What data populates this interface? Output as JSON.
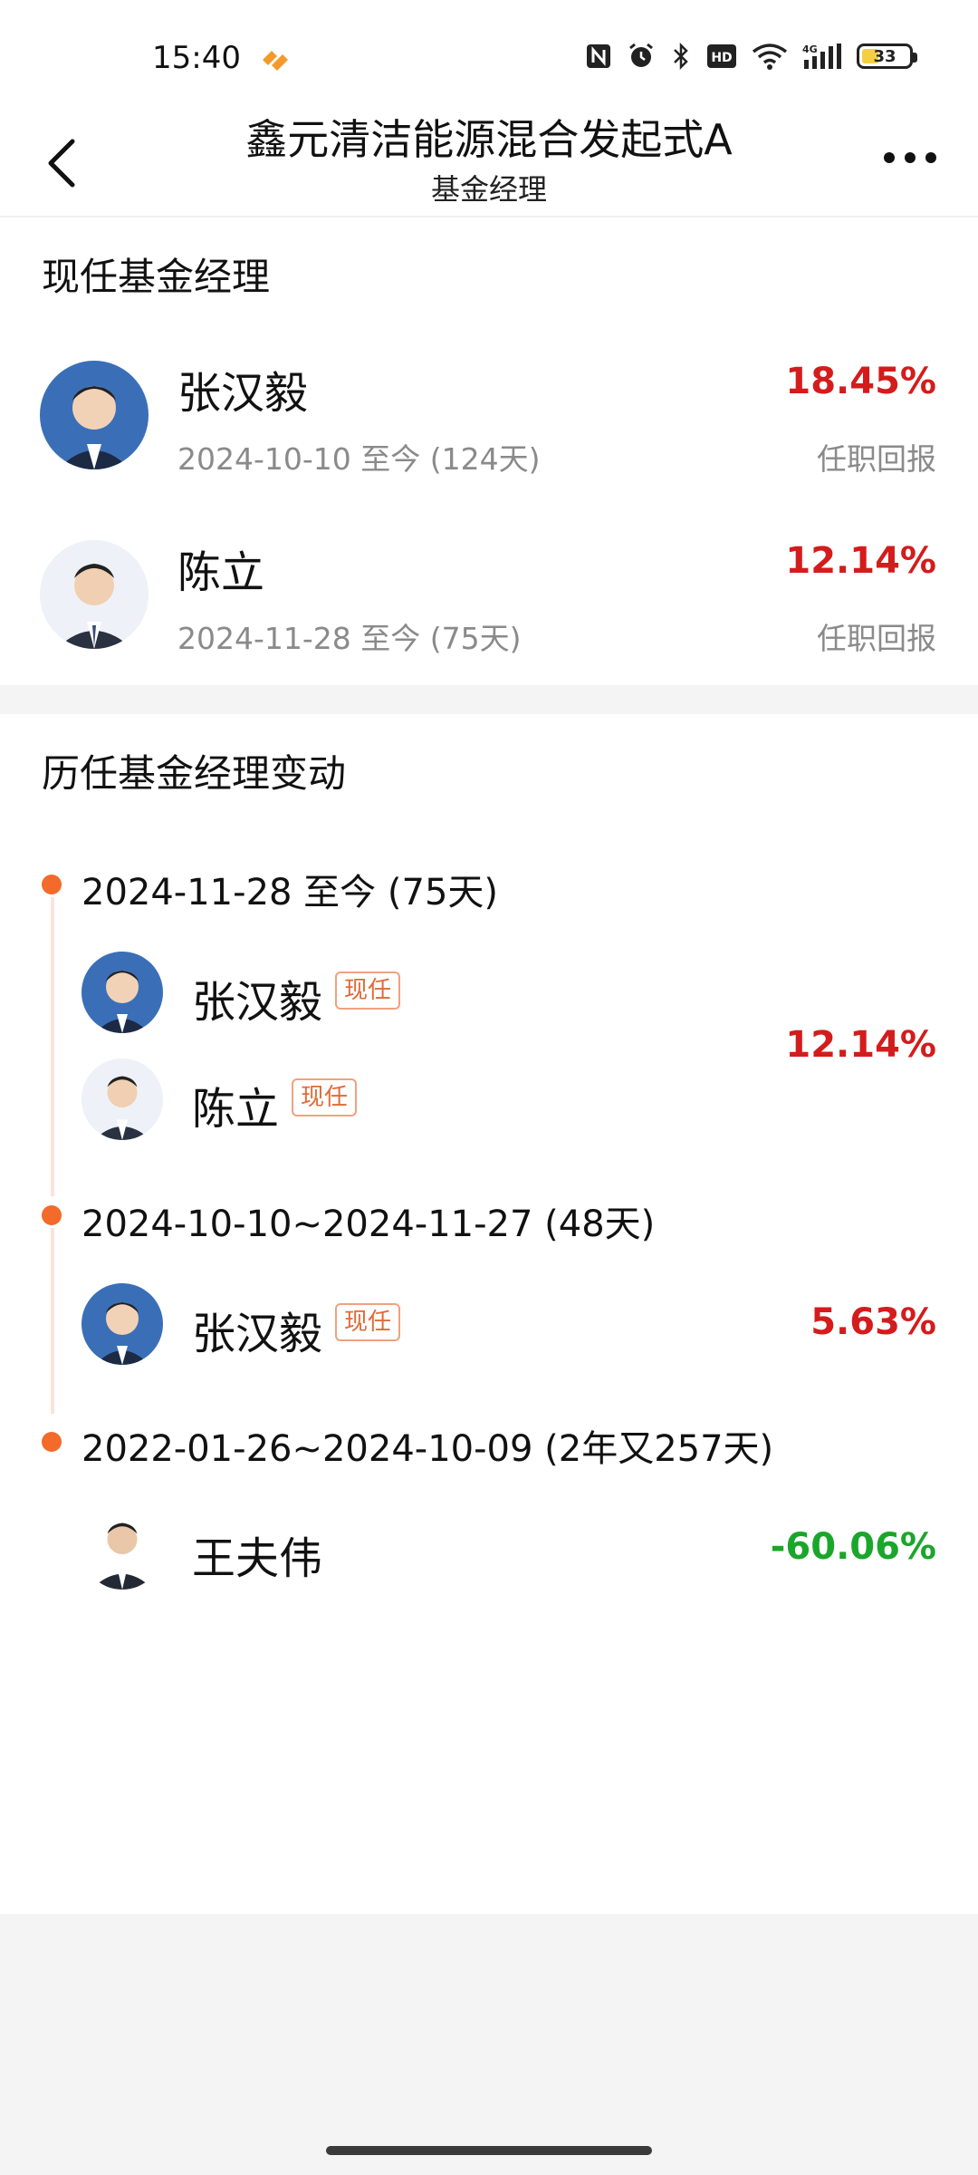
{
  "status_bar": {
    "time": "15:40",
    "battery_level": "33",
    "icons": [
      "nfc-icon",
      "alarm-icon",
      "bluetooth-icon",
      "hd-icon",
      "wifi-icon",
      "4g-signal-icon",
      "battery-icon"
    ]
  },
  "header": {
    "title": "鑫元清洁能源混合发起式A",
    "subtitle": "基金经理"
  },
  "current_section": {
    "title": "现任基金经理",
    "managers": [
      {
        "name": "张汉毅",
        "tenure": "2024-10-10 至今 (124天)",
        "return": "18.45%",
        "return_label": "任职回报"
      },
      {
        "name": "陈立",
        "tenure": "2024-11-28 至今 (75天)",
        "return": "12.14%",
        "return_label": "任职回报"
      }
    ]
  },
  "history_section": {
    "title": "历任基金经理变动",
    "periods": [
      {
        "period": "2024-11-28 至今 (75天)",
        "managers": [
          {
            "name": "张汉毅",
            "tag": "现任"
          },
          {
            "name": "陈立",
            "tag": "现任"
          }
        ],
        "return": "12.14%"
      },
      {
        "period": "2024-10-10~2024-11-27  (48天)",
        "managers": [
          {
            "name": "张汉毅",
            "tag": "现任"
          }
        ],
        "return": "5.63%"
      },
      {
        "period": "2022-01-26~2024-10-09  (2年又257天)",
        "managers": [
          {
            "name": "王夫伟",
            "tag": ""
          }
        ],
        "return": "-60.06%"
      }
    ]
  },
  "colors": {
    "positive": "#d41c1c",
    "negative": "#1aa62a",
    "accent": "#f36a2a",
    "muted": "#8a8a8a"
  }
}
